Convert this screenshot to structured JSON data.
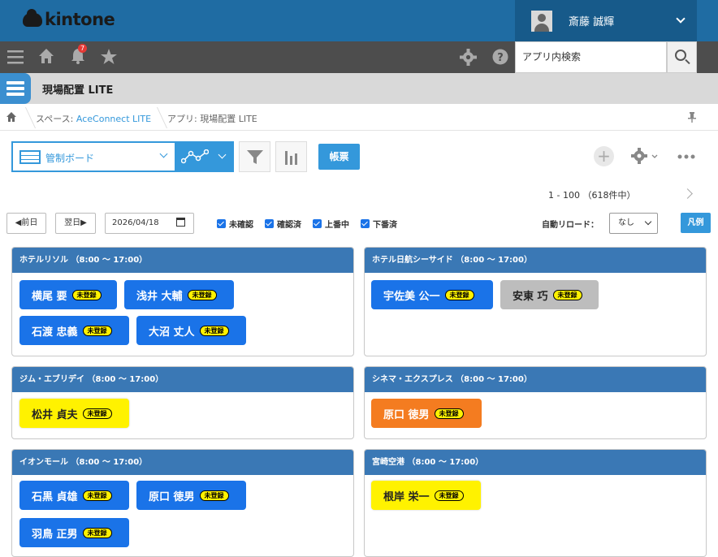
{
  "header": {
    "logo_text": "kintone",
    "user_name": "斎藤 誠輝"
  },
  "navbar": {
    "notification_count": "7",
    "search_placeholder": "アプリ内検索"
  },
  "app": {
    "title": "現場配置 LITE"
  },
  "breadcrumb": {
    "space_prefix": "スペース: ",
    "space_name": "AceConnect LITE",
    "app_label": "アプリ: 現場配置 LITE"
  },
  "toolbar": {
    "view_name": "管制ボード",
    "print_label": "帳票",
    "paging": "1 - 100 （618件中）"
  },
  "controls": {
    "prev_label": "◀前日",
    "next_label": "翌日▶",
    "date_value": "2026/04/18",
    "checkboxes": [
      "未確認",
      "確認済",
      "上番中",
      "下番済"
    ],
    "reload_label": "自動リロード：",
    "reload_value": "なし",
    "legend_label": "凡例"
  },
  "badge_text": "未登録",
  "sites": [
    {
      "name": "ホテルリソル （8:00 ～ 17:00）",
      "staff": [
        "横尾 要",
        "浅井 大輔",
        "石渡 忠義",
        "大沼 丈人"
      ]
    },
    {
      "name": "ホテル日航シーサイド （8:00 ～ 17:00）",
      "staff": [
        "宇佐美 公一",
        "安東 巧"
      ]
    },
    {
      "name": "ジム・エブリデイ （8:00 ～ 17:00）",
      "staff": [
        "松井 貞夫"
      ]
    },
    {
      "name": "シネマ・エクスプレス （8:00 ～ 17:00）",
      "staff": [
        "原口 徳男"
      ]
    },
    {
      "name": "イオンモール （8:00 ～ 17:00）",
      "staff": [
        "石黒 貞雄",
        "原口 徳男",
        "羽鳥 正男"
      ]
    },
    {
      "name": "宮崎空港 （8:00 ～ 17:00）",
      "staff": [
        "根岸 栄一"
      ]
    }
  ],
  "colors": {
    "blue": "#1a73e8",
    "gray": "#bdbdbd",
    "yellow": "#fff200",
    "orange": "#f47c20",
    "header": "#3a78b5"
  }
}
